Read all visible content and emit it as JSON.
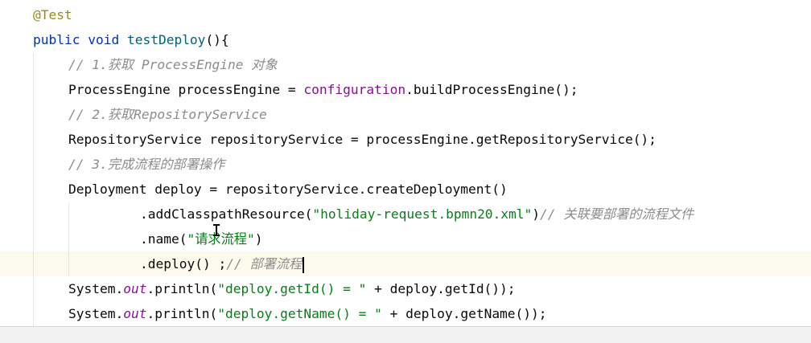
{
  "editor": {
    "lines": [
      {
        "tokens": [
          {
            "t": "@Test",
            "c": "ann"
          }
        ]
      },
      {
        "tokens": [
          {
            "t": "public",
            "c": "kw"
          },
          {
            "t": " "
          },
          {
            "t": "void",
            "c": "kw"
          },
          {
            "t": " "
          },
          {
            "t": "testDeploy",
            "c": "fn"
          },
          {
            "t": "(){"
          }
        ]
      },
      {
        "tokens": [
          {
            "t": "// 1.获取 ProcessEngine 对象",
            "c": "cm"
          }
        ]
      },
      {
        "tokens": [
          {
            "t": "ProcessEngine processEngine = "
          },
          {
            "t": "configuration",
            "c": "fld"
          },
          {
            "t": ".buildProcessEngine();"
          }
        ]
      },
      {
        "tokens": [
          {
            "t": "// 2.获取RepositoryService",
            "c": "cm"
          }
        ]
      },
      {
        "tokens": [
          {
            "t": "RepositoryService repositoryService = processEngine.getRepositoryService();"
          }
        ]
      },
      {
        "tokens": [
          {
            "t": "// 3.完成流程的部署操作",
            "c": "cm"
          }
        ]
      },
      {
        "tokens": [
          {
            "t": "Deployment deploy = repositoryService.createDeployment()"
          }
        ]
      },
      {
        "tokens": [
          {
            "t": ".addClasspathResource("
          },
          {
            "t": "\"holiday-request.bpmn20.xml\"",
            "c": "str"
          },
          {
            "t": ")"
          },
          {
            "t": "// 关联要部署的流程文件",
            "c": "cm"
          }
        ]
      },
      {
        "tokens": [
          {
            "t": ".name("
          },
          {
            "t": "\"请求流程\"",
            "c": "str"
          },
          {
            "t": ")"
          }
        ]
      },
      {
        "tokens": [
          {
            "t": ".deploy() ;"
          },
          {
            "t": "// 部署流程",
            "c": "cm"
          }
        ]
      },
      {
        "tokens": [
          {
            "t": "System."
          },
          {
            "t": "out",
            "c": "sfld"
          },
          {
            "t": ".println("
          },
          {
            "t": "\"deploy.getId() = \"",
            "c": "str"
          },
          {
            "t": " + deploy.getId());"
          }
        ]
      },
      {
        "tokens": [
          {
            "t": "System."
          },
          {
            "t": "out",
            "c": "sfld"
          },
          {
            "t": ".println("
          },
          {
            "t": "\"deploy.getName() = \"",
            "c": "str"
          },
          {
            "t": " + deploy.getName());"
          }
        ]
      }
    ],
    "current_line_index": 10,
    "colors": {
      "keyword": "#0033b3",
      "method": "#00627a",
      "annotation": "#9e880d",
      "comment": "#8c8c8c",
      "string": "#067d17",
      "field": "#871094",
      "current_line_bg": "#fcfaed"
    }
  },
  "icons": {
    "mouse_cursor": "i-beam-cursor-icon"
  }
}
